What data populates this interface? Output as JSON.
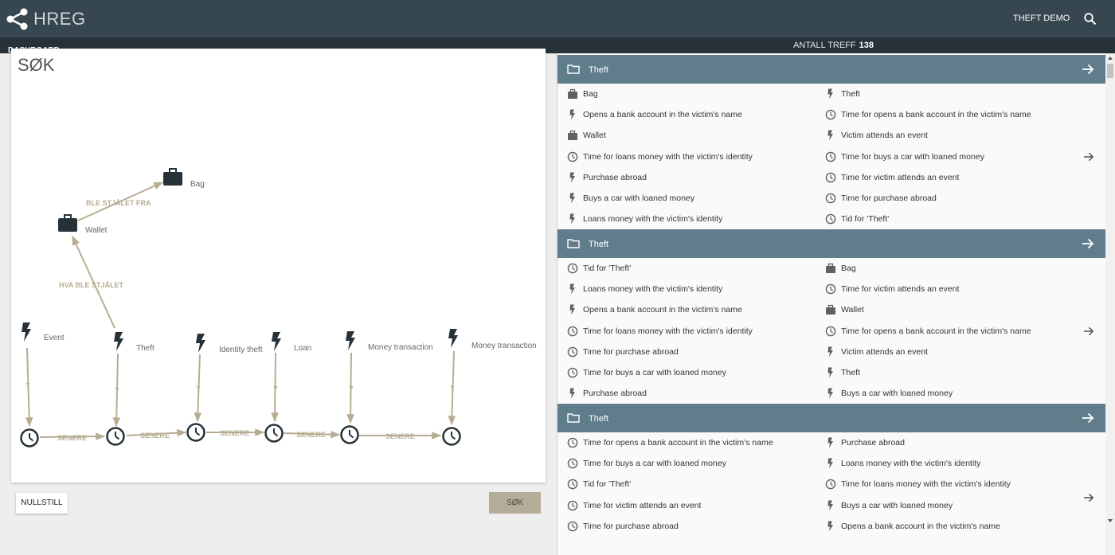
{
  "app": {
    "title": "HREG",
    "user": "THEFT DEMO"
  },
  "subbar": {
    "dashboard_label": "DASHBOARD",
    "hits_label": "ANTALL TREFF",
    "hits_count": "138"
  },
  "search": {
    "title": "SØK",
    "nodes": {
      "bag": "Bag",
      "wallet": "Wallet",
      "event": "Event",
      "theft": "Theft",
      "identity_theft": "Identity theft",
      "loan": "Loan",
      "money_transaction_1": "Money transaction",
      "money_transaction_2": "Money transaction"
    },
    "edges": {
      "stolen_from": "BLE STJÅLET FRA",
      "what_stolen": "HVA BLE STJÅLET",
      "later": "SENERE",
      "unknown": "?"
    },
    "reset_label": "NULLSTILL",
    "search_label": "SØK"
  },
  "results": [
    {
      "title": "Theft",
      "left": [
        {
          "icon": "briefcase-icon",
          "label": "Bag"
        },
        {
          "icon": "lightning-icon",
          "label": "Opens a bank account in the victim's name"
        },
        {
          "icon": "briefcase-icon",
          "label": "Wallet"
        },
        {
          "icon": "clock-icon",
          "label": "Time for loans money with the victim's identity"
        },
        {
          "icon": "lightning-icon",
          "label": "Purchase abroad"
        },
        {
          "icon": "lightning-icon",
          "label": "Buys a car with loaned money"
        },
        {
          "icon": "lightning-icon",
          "label": "Loans money with the victim's identity"
        }
      ],
      "right": [
        {
          "icon": "lightning-icon",
          "label": "Theft"
        },
        {
          "icon": "clock-icon",
          "label": "Time for opens a bank account in the victim's name"
        },
        {
          "icon": "lightning-icon",
          "label": "Victim attends an event"
        },
        {
          "icon": "clock-icon",
          "label": "Time for buys a car with loaned money"
        },
        {
          "icon": "clock-icon",
          "label": "Time for victim attends an event"
        },
        {
          "icon": "clock-icon",
          "label": "Time for purchase abroad"
        },
        {
          "icon": "clock-icon",
          "label": "Tid for 'Theft'"
        }
      ]
    },
    {
      "title": "Theft",
      "left": [
        {
          "icon": "clock-icon",
          "label": "Tid for 'Theft'"
        },
        {
          "icon": "lightning-icon",
          "label": "Loans money with the victim's identity"
        },
        {
          "icon": "lightning-icon",
          "label": "Opens a bank account in the victim's name"
        },
        {
          "icon": "clock-icon",
          "label": "Time for loans money with the victim's identity"
        },
        {
          "icon": "clock-icon",
          "label": "Time for purchase abroad"
        },
        {
          "icon": "clock-icon",
          "label": "Time for buys a car with loaned money"
        },
        {
          "icon": "lightning-icon",
          "label": "Purchase abroad"
        }
      ],
      "right": [
        {
          "icon": "briefcase-icon",
          "label": "Bag"
        },
        {
          "icon": "clock-icon",
          "label": "Time for victim attends an event"
        },
        {
          "icon": "briefcase-icon",
          "label": "Wallet"
        },
        {
          "icon": "clock-icon",
          "label": "Time for opens a bank account in the victim's name"
        },
        {
          "icon": "lightning-icon",
          "label": "Victim attends an event"
        },
        {
          "icon": "lightning-icon",
          "label": "Theft"
        },
        {
          "icon": "lightning-icon",
          "label": "Buys a car with loaned money"
        }
      ]
    },
    {
      "title": "Theft",
      "left": [
        {
          "icon": "clock-icon",
          "label": "Time for opens a bank account in the victim's name"
        },
        {
          "icon": "clock-icon",
          "label": "Time for buys a car with loaned money"
        },
        {
          "icon": "clock-icon",
          "label": "Tid for 'Theft'"
        },
        {
          "icon": "clock-icon",
          "label": "Time for victim attends an event"
        },
        {
          "icon": "clock-icon",
          "label": "Time for purchase abroad"
        }
      ],
      "right": [
        {
          "icon": "lightning-icon",
          "label": "Purchase abroad"
        },
        {
          "icon": "lightning-icon",
          "label": "Loans money with the victim's identity"
        },
        {
          "icon": "clock-icon",
          "label": "Time for loans money with the victim's identity"
        },
        {
          "icon": "lightning-icon",
          "label": "Buys a car with loaned money"
        },
        {
          "icon": "lightning-icon",
          "label": "Opens a bank account in the victim's name"
        }
      ]
    }
  ]
}
